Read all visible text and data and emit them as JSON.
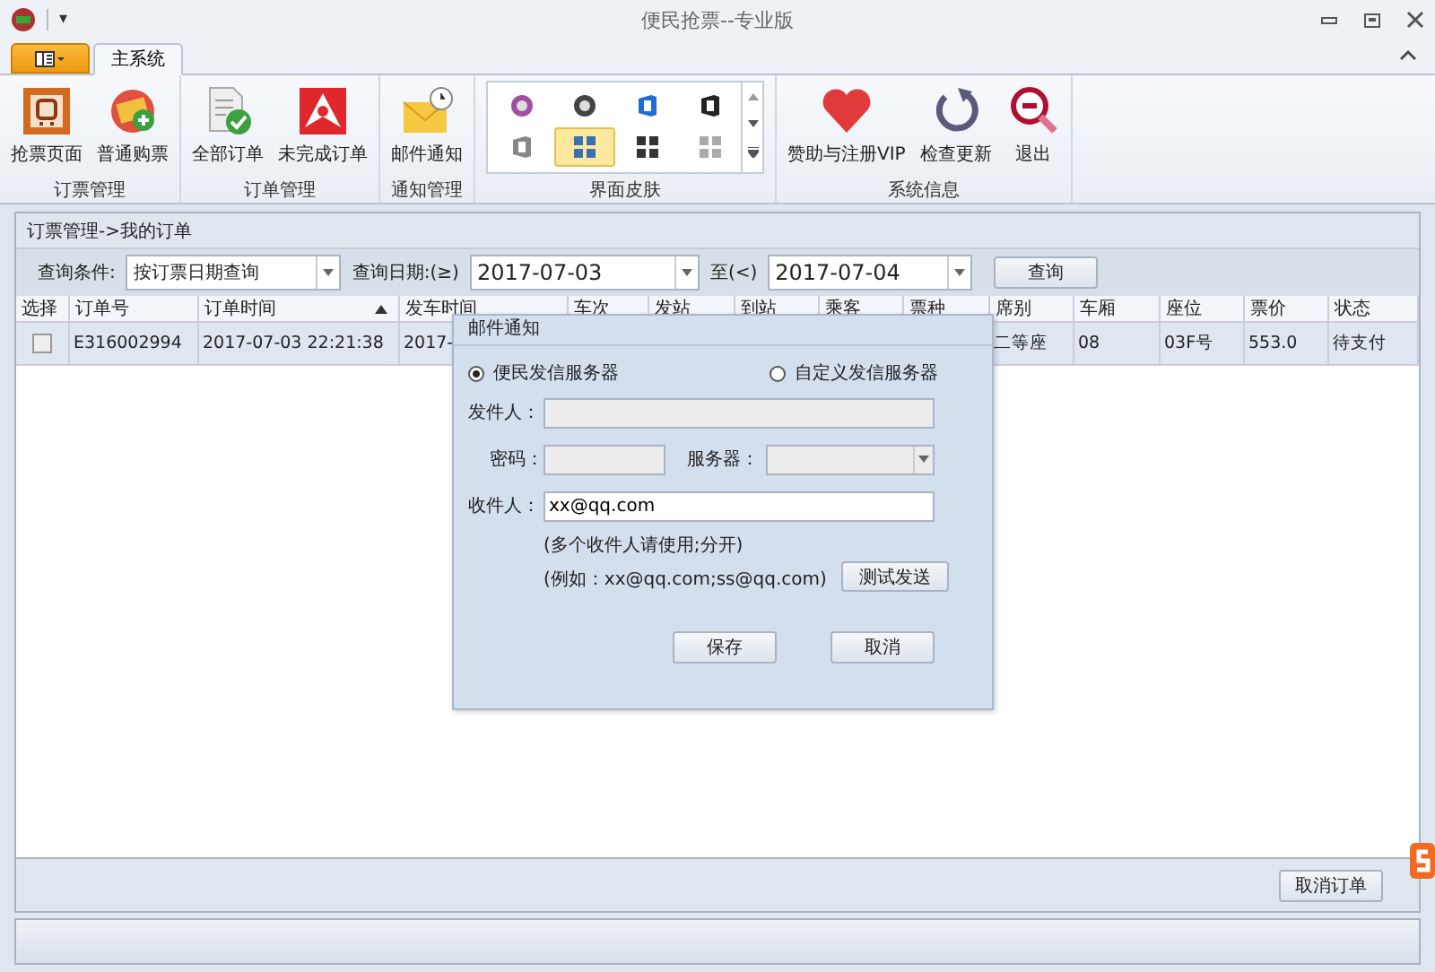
{
  "window": {
    "title": "便民抢票--专业版",
    "quick_access": "▾"
  },
  "tabs": [
    {
      "label": "主系统",
      "selected": true
    }
  ],
  "ribbon_groups": [
    {
      "title": "订票管理",
      "buttons": [
        {
          "label": "抢票页面",
          "kind": "bus"
        },
        {
          "label": "普通购票",
          "kind": "ticket"
        }
      ]
    },
    {
      "title": "订单管理",
      "buttons": [
        {
          "label": "全部订单",
          "kind": "doc-check"
        },
        {
          "label": "未完成订单",
          "kind": "red-app"
        }
      ]
    },
    {
      "title": "通知管理",
      "buttons": [
        {
          "label": "邮件通知",
          "kind": "mail"
        }
      ]
    },
    {
      "title": "界面皮肤",
      "skins": [
        {
          "kind": "disc-purple",
          "selected": false
        },
        {
          "kind": "disc-dark",
          "selected": false
        },
        {
          "kind": "office-blue",
          "selected": false
        },
        {
          "kind": "office-black",
          "selected": false
        },
        {
          "kind": "office-grey",
          "selected": false
        },
        {
          "kind": "tiles-blue",
          "selected": true
        },
        {
          "kind": "tiles-dark",
          "selected": false
        },
        {
          "kind": "tiles-light",
          "selected": false
        }
      ]
    },
    {
      "title": "系统信息",
      "buttons": [
        {
          "label": "赞助与注册VIP",
          "kind": "heart"
        },
        {
          "label": "检查更新",
          "kind": "refresh"
        },
        {
          "label": "退出",
          "kind": "zoom-out"
        }
      ]
    }
  ],
  "breadcrumb": "订票管理->我的订单",
  "query": {
    "condition_label": "查询条件:",
    "condition": "按订票日期查询",
    "date_label": "查询日期:(≥)",
    "date_from": "2017-07-03",
    "to_label": "至(<)",
    "date_to": "2017-07-04",
    "button": "查询"
  },
  "table": {
    "columns": [
      {
        "label": "选择"
      },
      {
        "label": "订单号"
      },
      {
        "label": "订单时间",
        "sorted": true
      },
      {
        "label": "发车时间"
      },
      {
        "label": "车次"
      },
      {
        "label": "发站"
      },
      {
        "label": "到站"
      },
      {
        "label": "乘客"
      },
      {
        "label": "票种"
      },
      {
        "label": "席别"
      },
      {
        "label": "车厢"
      },
      {
        "label": "座位"
      },
      {
        "label": "票价"
      },
      {
        "label": "状态"
      }
    ],
    "rows": [
      {
        "cells": [
          {
            "kind": "checkbox",
            "checked": false
          },
          "E316002994",
          "2017-07-03 22:21:38",
          "2017-",
          null,
          null,
          null,
          null,
          null,
          "二等座",
          "08",
          "03F号",
          "553.0",
          "待支付"
        ]
      }
    ]
  },
  "cancel_button": "取消订单",
  "dialog": {
    "title": "邮件通知",
    "servers": [
      {
        "label": "便民发信服务器",
        "selected": true
      },
      {
        "label": "自定义发信服务器",
        "selected": false
      }
    ],
    "sender_label": "发件人：",
    "password_label": "密码：",
    "server_label": "服务器：",
    "fields_disabled": true,
    "recipient_label": "收件人：",
    "recipient": "xx@qq.com",
    "hint_1": "(多个收件人请使用;分开)",
    "hint_2": "(例如：xx@qq.com;ss@qq.com)",
    "test_button": "测试发送",
    "save_button": "保存",
    "cancel_button": "取消"
  }
}
